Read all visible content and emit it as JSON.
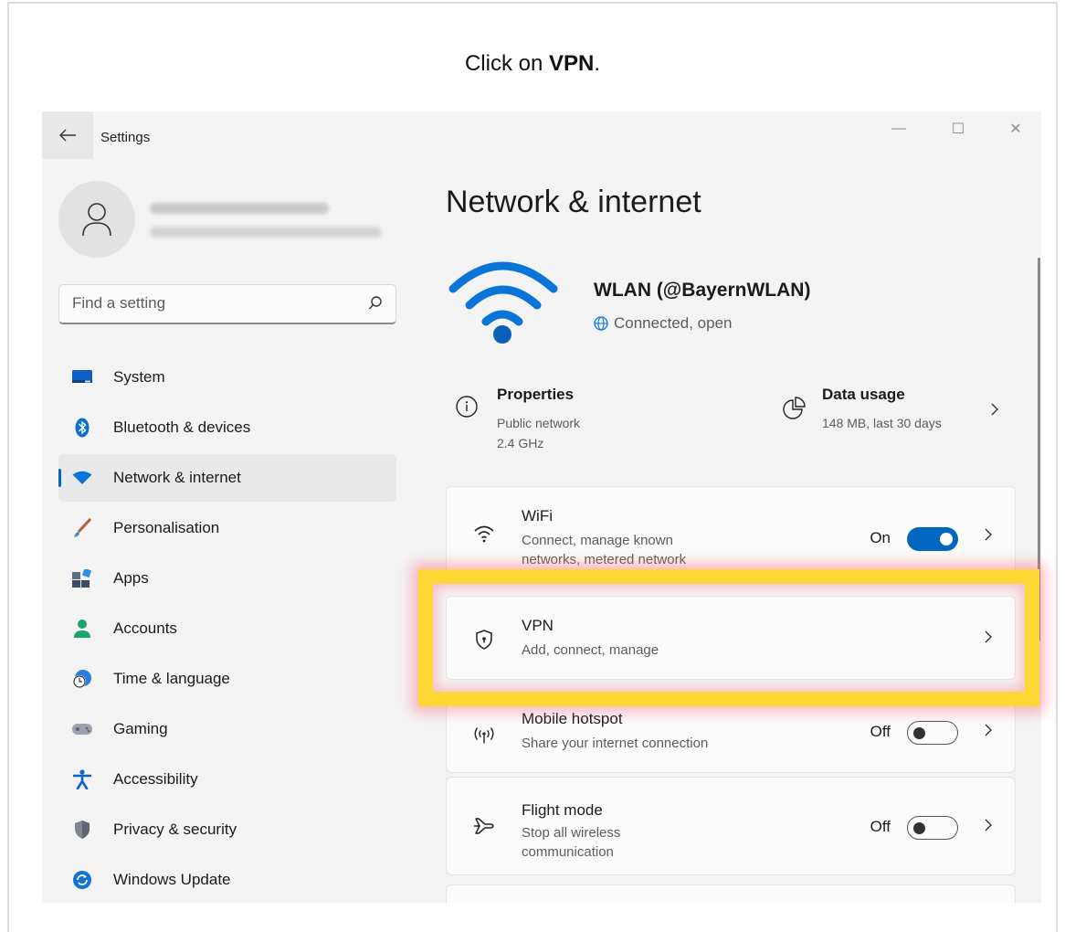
{
  "instruction": {
    "prefix": "Click on ",
    "target": "VPN",
    "suffix": "."
  },
  "window": {
    "title": "Settings",
    "controls": {
      "minimize": "—",
      "maximize": "☐",
      "close": "✕"
    }
  },
  "search": {
    "placeholder": "Find a setting"
  },
  "sidebar": {
    "items": [
      {
        "label": "System",
        "icon": "system-icon"
      },
      {
        "label": "Bluetooth & devices",
        "icon": "bluetooth-icon"
      },
      {
        "label": "Network & internet",
        "icon": "wifi-icon",
        "active": true
      },
      {
        "label": "Personalisation",
        "icon": "brush-icon"
      },
      {
        "label": "Apps",
        "icon": "apps-icon"
      },
      {
        "label": "Accounts",
        "icon": "accounts-icon"
      },
      {
        "label": "Time & language",
        "icon": "clock-globe-icon"
      },
      {
        "label": "Gaming",
        "icon": "gamepad-icon"
      },
      {
        "label": "Accessibility",
        "icon": "accessibility-icon"
      },
      {
        "label": "Privacy & security",
        "icon": "shield-icon"
      },
      {
        "label": "Windows Update",
        "icon": "update-icon"
      }
    ]
  },
  "main": {
    "title": "Network & internet",
    "network": {
      "name": "WLAN (@BayernWLAN)",
      "status": "Connected, open"
    },
    "properties": {
      "title": "Properties",
      "line1": "Public network",
      "line2": "2.4 GHz"
    },
    "data_usage": {
      "title": "Data usage",
      "sub": "148 MB, last 30 days"
    },
    "cards": {
      "wifi": {
        "title": "WiFi",
        "sub1": "Connect, manage known",
        "sub2": "networks, metered network",
        "state": "On"
      },
      "vpn": {
        "title": "VPN",
        "sub": "Add, connect, manage"
      },
      "hotspot": {
        "title": "Mobile hotspot",
        "sub": "Share your internet connection",
        "state": "Off"
      },
      "flight": {
        "title": "Flight mode",
        "sub1": "Stop all wireless",
        "sub2": "communication",
        "state": "Off"
      }
    }
  },
  "colors": {
    "accent": "#0067c0",
    "highlight": "#fdd835",
    "glow": "#ff5a6e"
  }
}
